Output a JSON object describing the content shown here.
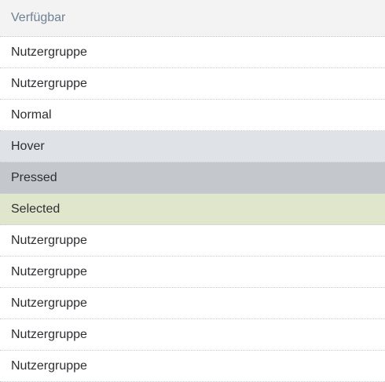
{
  "list": {
    "header": "Verfügbar",
    "items": [
      {
        "label": "Nutzergruppe",
        "state": "normal"
      },
      {
        "label": "Nutzergruppe",
        "state": "normal"
      },
      {
        "label": "Normal",
        "state": "normal"
      },
      {
        "label": "Hover",
        "state": "hover"
      },
      {
        "label": "Pressed",
        "state": "pressed"
      },
      {
        "label": "Selected",
        "state": "selected"
      },
      {
        "label": "Nutzergruppe",
        "state": "normal"
      },
      {
        "label": "Nutzergruppe",
        "state": "normal"
      },
      {
        "label": "Nutzergruppe",
        "state": "normal"
      },
      {
        "label": "Nutzergruppe",
        "state": "normal"
      },
      {
        "label": "Nutzergruppe",
        "state": "normal"
      }
    ]
  },
  "colors": {
    "header_bg": "#f3f3f4",
    "header_text": "#6f8093",
    "hover_bg": "#dfe3e7",
    "pressed_bg": "#c4c8cd",
    "selected_bg": "#dfe6cc",
    "divider": "#c9cdd2"
  }
}
